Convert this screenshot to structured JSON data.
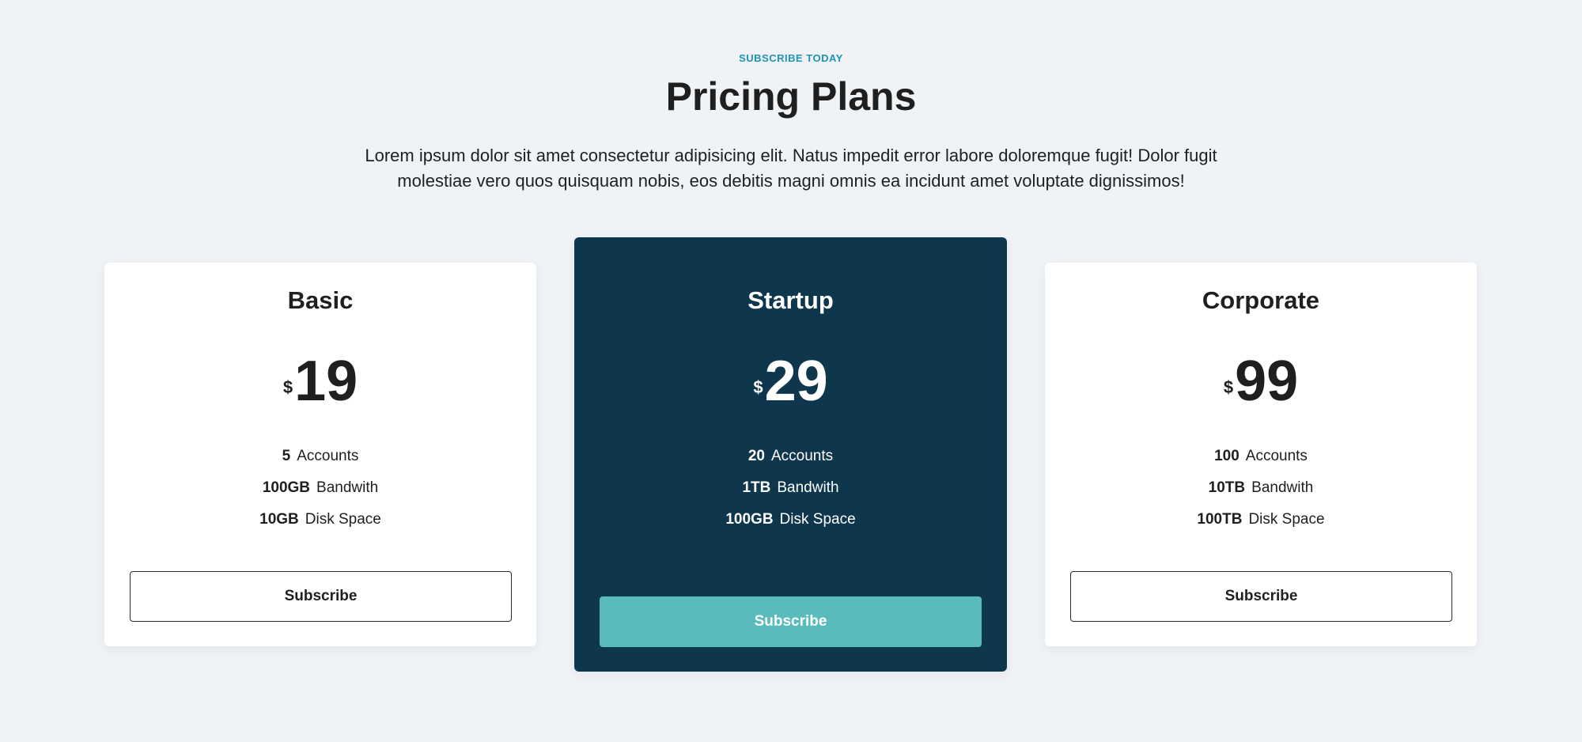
{
  "header": {
    "eyebrow": "SUBSCRIBE TODAY",
    "title": "Pricing Plans",
    "intro": "Lorem ipsum dolor sit amet consectetur adipisicing elit. Natus impedit error labore doloremque fugit! Dolor fugit molestiae vero quos quisquam nobis, eos debitis magni omnis ea incidunt amet voluptate dignissimos!"
  },
  "colors": {
    "background": "#eff3f6",
    "accent": "#1f93b4",
    "featured_card": "#0e374d",
    "featured_button": "#5abbbd"
  },
  "plans": [
    {
      "name": "Basic",
      "currency": "$",
      "price": "19",
      "features": [
        {
          "value": "5",
          "label": "Accounts"
        },
        {
          "value": "100GB",
          "label": "Bandwith"
        },
        {
          "value": "10GB",
          "label": "Disk Space"
        }
      ],
      "button": "Subscribe"
    },
    {
      "name": "Startup",
      "currency": "$",
      "price": "29",
      "features": [
        {
          "value": "20",
          "label": "Accounts"
        },
        {
          "value": "1TB",
          "label": "Bandwith"
        },
        {
          "value": "100GB",
          "label": "Disk Space"
        }
      ],
      "button": "Subscribe"
    },
    {
      "name": "Corporate",
      "currency": "$",
      "price": "99",
      "features": [
        {
          "value": "100",
          "label": "Accounts"
        },
        {
          "value": "10TB",
          "label": "Bandwith"
        },
        {
          "value": "100TB",
          "label": "Disk Space"
        }
      ],
      "button": "Subscribe"
    }
  ]
}
